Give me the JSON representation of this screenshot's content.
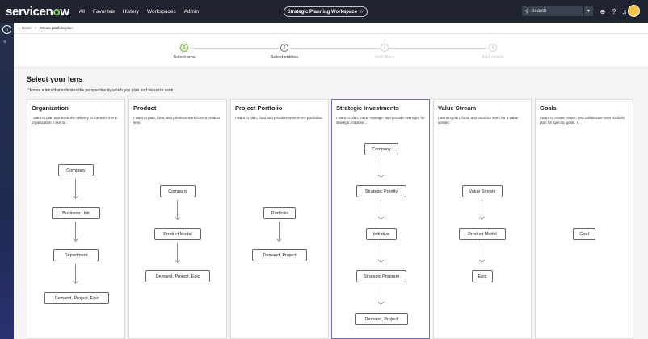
{
  "topnav": {
    "logo_text": "servicenow",
    "links": [
      "All",
      "Favorites",
      "History",
      "Workspaces",
      "Admin"
    ],
    "workspace": "Strategic Planning Workspace",
    "star": "☆",
    "search_placeholder": "Search"
  },
  "breadcrumb": {
    "home": "Home",
    "current": "Create portfolio plan"
  },
  "steps": [
    {
      "num": "1",
      "label": "Select lens",
      "state": "active"
    },
    {
      "num": "2",
      "label": "Select entities",
      "state": "done"
    },
    {
      "num": "3",
      "label": "Add filters",
      "state": "pending"
    },
    {
      "num": "4",
      "label": "Add details",
      "state": "pending"
    }
  ],
  "main": {
    "title": "Select your lens",
    "subtitle": "Choose a lens that indicates the perspective by which you plan and visualize work."
  },
  "lenses": [
    {
      "title": "Organization",
      "desc": "I want to plan and track the delivery of the work in my organization. I like to...",
      "nodes": [
        "Company",
        "Business Unit",
        "Department",
        "Demand, Project, Epic"
      ]
    },
    {
      "title": "Product",
      "desc": "I want to plan, fund, and prioritize work from a product lens.",
      "nodes": [
        "Company",
        "Product Model",
        "Demand, Project, Epic"
      ]
    },
    {
      "title": "Project Portfolio",
      "desc": "I want to plan, fund and prioritize work in my portfolios.",
      "nodes": [
        "Portfolio",
        "Demand, Project"
      ]
    },
    {
      "title": "Strategic Investments",
      "desc": "I want to plan, track, manage, and provide oversight for strategic initiative...",
      "nodes": [
        "Company",
        "Strategic Priority",
        "Initiative",
        "Strategic Program",
        "Demand, Project"
      ],
      "selected": true
    },
    {
      "title": "Value Stream",
      "desc": "I want to plan, fund, and prioritize work for a value stream.",
      "nodes": [
        "Value Stream",
        "Product Model",
        "Epic"
      ]
    },
    {
      "title": "Goals",
      "desc": "I want to create, share, and collaborate on a portfolio plan for specific goals. I...",
      "nodes": [
        "Goal"
      ]
    }
  ],
  "colors": {
    "nav_bg": "#1f2430",
    "logo_accent": "#7fd35b",
    "selected_border": "#6e74b8",
    "active_step": "#7fb24e"
  },
  "icons": [
    "home-icon",
    "menu-icon",
    "star-icon",
    "search-icon",
    "globe-icon",
    "help-icon",
    "bell-icon",
    "avatar"
  ]
}
